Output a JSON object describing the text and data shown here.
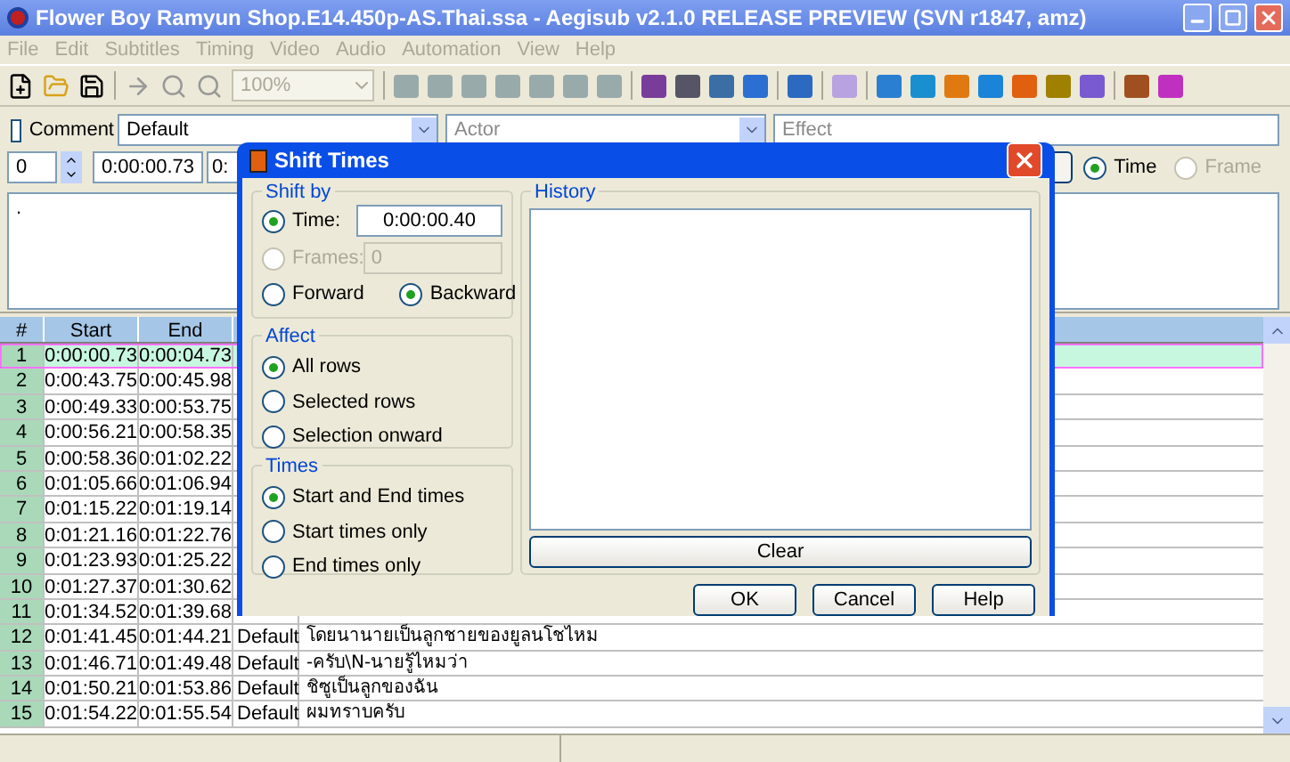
{
  "window": {
    "title": "Flower Boy Ramyun Shop.E14.450p-AS.Thai.ssa - Aegisub v2.1.0 RELEASE PREVIEW (SVN r1847, amz)"
  },
  "menu": [
    "File",
    "Edit",
    "Subtitles",
    "Timing",
    "Video",
    "Audio",
    "Automation",
    "View",
    "Help"
  ],
  "toolbar": {
    "zoom": "100%"
  },
  "edit_box": {
    "comment": {
      "label": "Comment",
      "checked": false
    },
    "style": "Default",
    "actor": {
      "placeholder": "Actor"
    },
    "effect": {
      "placeholder": "Effect"
    },
    "layer": "0",
    "start_time": "0:00:00.73",
    "end_time": "0:",
    "time_mode": [
      {
        "label": "Time",
        "selected": true,
        "disabled": false
      },
      {
        "label": "Frame",
        "selected": false,
        "disabled": true
      }
    ],
    "text": "."
  },
  "grid": {
    "columns": [
      "#",
      "Start",
      "End"
    ],
    "rows": [
      {
        "number": "1",
        "start": "0:00:00.73",
        "end": "0:00:04.73",
        "selected": true
      },
      {
        "number": "2",
        "start": "0:00:43.75",
        "end": "0:00:45.98",
        "selected": false
      },
      {
        "number": "3",
        "start": "0:00:49.33",
        "end": "0:00:53.75",
        "selected": false
      },
      {
        "number": "4",
        "start": "0:00:56.21",
        "end": "0:00:58.35",
        "selected": false
      },
      {
        "number": "5",
        "start": "0:00:58.36",
        "end": "0:01:02.22",
        "selected": false
      },
      {
        "number": "6",
        "start": "0:01:05.66",
        "end": "0:01:06.94",
        "selected": false
      },
      {
        "number": "7",
        "start": "0:01:15.22",
        "end": "0:01:19.14",
        "selected": false
      },
      {
        "number": "8",
        "start": "0:01:21.16",
        "end": "0:01:22.76",
        "selected": false
      },
      {
        "number": "9",
        "start": "0:01:23.93",
        "end": "0:01:25.22",
        "selected": false
      },
      {
        "number": "10",
        "start": "0:01:27.37",
        "end": "0:01:30.62",
        "selected": false
      },
      {
        "number": "11",
        "start": "0:01:34.52",
        "end": "0:01:39.68",
        "selected": false
      },
      {
        "number": "12",
        "start": "0:01:41.45",
        "end": "0:01:44.21",
        "style": "Default",
        "text": "โดยนานายเป็นลูกชายของยูลนโชไหม",
        "selected": false
      },
      {
        "number": "13",
        "start": "0:01:46.71",
        "end": "0:01:49.48",
        "style": "Default",
        "text": "-ครับ\\N-นายรู้ไหมว่า",
        "selected": false
      },
      {
        "number": "14",
        "start": "0:01:50.21",
        "end": "0:01:53.86",
        "style": "Default",
        "text": "ชิซูเป็นลูกของฉัน",
        "selected": false
      },
      {
        "number": "15",
        "start": "0:01:54.22",
        "end": "0:01:55.54",
        "style": "Default",
        "text": "ผมทราบครับ",
        "selected": false
      }
    ]
  },
  "dialog": {
    "title": "Shift Times",
    "shift_by": {
      "label": "Shift by",
      "time": {
        "label": "Time:",
        "selected": true,
        "value": "0:00:00.40"
      },
      "frames": {
        "label": "Frames:",
        "selected": false,
        "disabled": true,
        "value": "0"
      },
      "direction": [
        {
          "label": "Forward",
          "selected": false
        },
        {
          "label": "Backward",
          "selected": true
        }
      ]
    },
    "history": {
      "label": "History",
      "clear_button": "Clear"
    },
    "affect": {
      "label": "Affect",
      "options": [
        {
          "label": "All rows",
          "selected": true
        },
        {
          "label": "Selected rows",
          "selected": false
        },
        {
          "label": "Selection onward",
          "selected": false
        }
      ]
    },
    "times": {
      "label": "Times",
      "options": [
        {
          "label": "Start and End times",
          "selected": true
        },
        {
          "label": "Start times only",
          "selected": false
        },
        {
          "label": "End times only",
          "selected": false
        }
      ]
    },
    "buttons": [
      "OK",
      "Cancel",
      "Help"
    ]
  }
}
